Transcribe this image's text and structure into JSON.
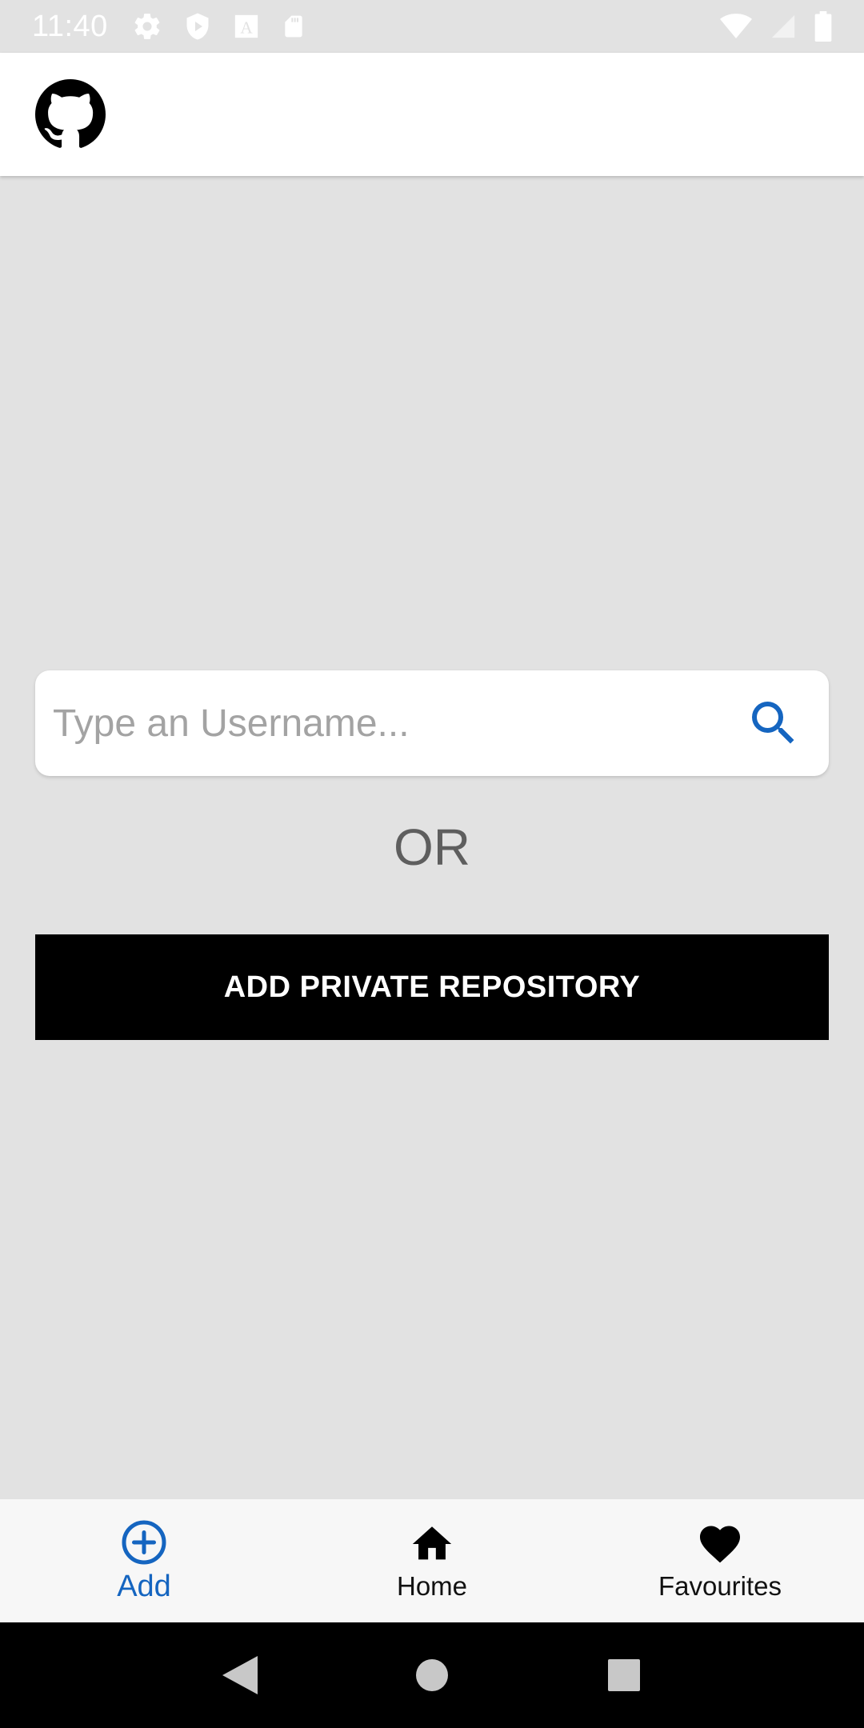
{
  "status_bar": {
    "time": "11:40",
    "left_icons": [
      "settings-icon",
      "shield-play-icon",
      "font-a-icon",
      "sd-card-icon"
    ],
    "right_icons": [
      "wifi-icon",
      "cell-signal-icon",
      "battery-icon"
    ]
  },
  "app_bar": {
    "logo": "github-logo-icon"
  },
  "search": {
    "placeholder": "Type an Username...",
    "value": "",
    "icon": "search-icon",
    "accent_color": "#1565c0"
  },
  "separator": {
    "or_text": "OR"
  },
  "actions": {
    "add_private_label": "ADD PRIVATE REPOSITORY"
  },
  "bottom_nav": {
    "items": [
      {
        "label": "Add",
        "icon": "add-circle-icon",
        "active": true
      },
      {
        "label": "Home",
        "icon": "home-icon",
        "active": false
      },
      {
        "label": "Favourites",
        "icon": "heart-icon",
        "active": false
      }
    ],
    "active_color": "#1565c0"
  },
  "system_nav": {
    "buttons": [
      "back-icon",
      "home-circle-icon",
      "recents-icon"
    ]
  }
}
